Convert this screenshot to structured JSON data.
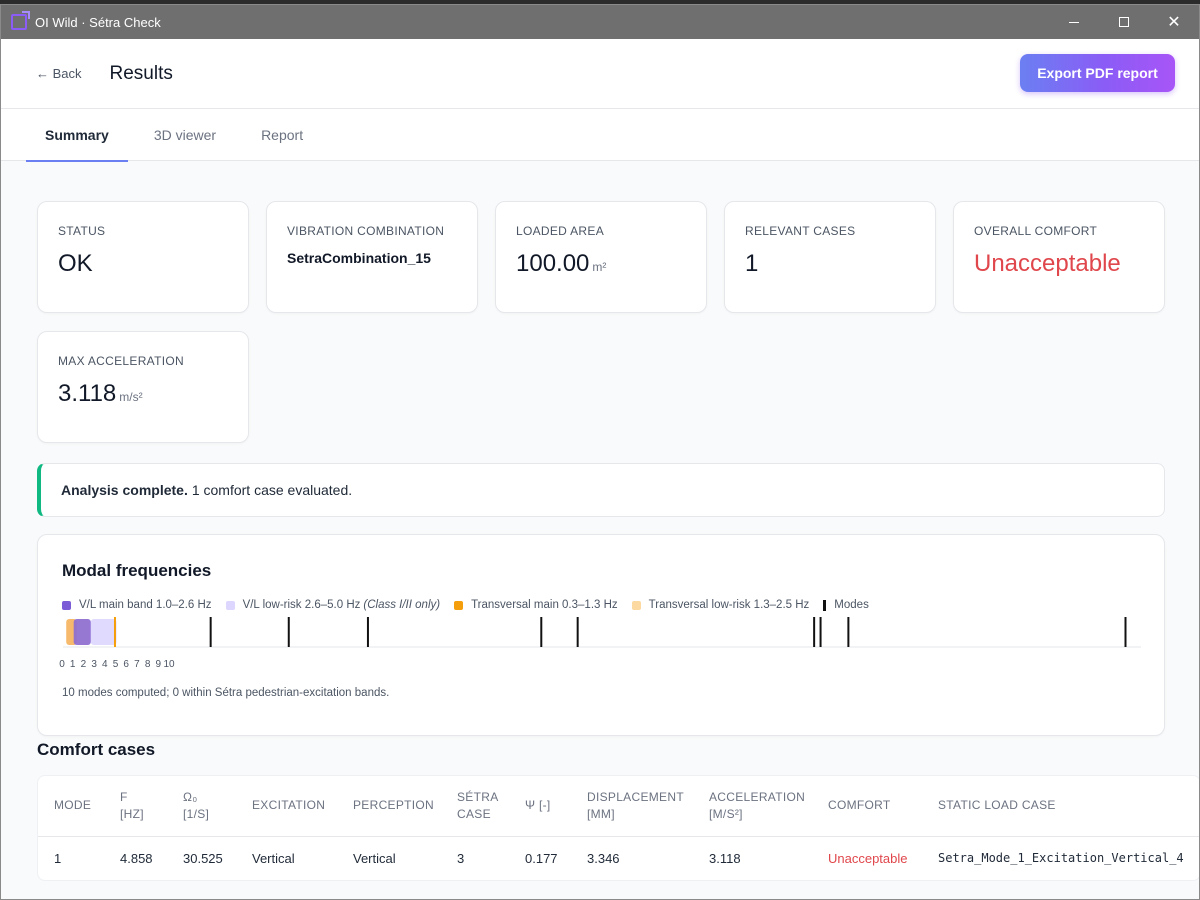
{
  "window": {
    "title": "OI Wild · Sétra Check"
  },
  "header": {
    "back_label": "← Back",
    "title": "Results",
    "export_label": "Export PDF report"
  },
  "tabs": [
    {
      "label": "Summary",
      "active": true
    },
    {
      "label": "3D viewer",
      "active": false
    },
    {
      "label": "Report",
      "active": false
    }
  ],
  "stats": {
    "status": {
      "label": "STATUS",
      "value": "OK"
    },
    "combination": {
      "label": "VIBRATION COMBINATION",
      "value": "SetraCombination_15"
    },
    "area": {
      "label": "LOADED AREA",
      "value": "100.00",
      "unit": "m²"
    },
    "cases": {
      "label": "RELEVANT CASES",
      "value": "1"
    },
    "comfort": {
      "label": "OVERALL COMFORT",
      "value": "Unacceptable"
    },
    "accel": {
      "label": "MAX ACCELERATION",
      "value": "3.118",
      "unit": "m/s²"
    }
  },
  "banner": {
    "strong": "Analysis complete.",
    "text": "1 comfort case evaluated."
  },
  "modal": {
    "title": "Modal frequencies",
    "legend": {
      "vl_main": "V/L main band 1.0–2.6 Hz",
      "vl_low": "V/L low-risk 2.6–5.0 Hz",
      "vl_low_note": "(Class I/II only)",
      "tr_main": "Transversal main 0.3–1.3 Hz",
      "tr_low": "Transversal low-risk 1.3–2.5 Hz",
      "modes": "Modes"
    },
    "note": "10 modes computed; 0 within Sétra pedestrian-excitation bands."
  },
  "chart_data": {
    "type": "scatter",
    "title": "Modal frequencies",
    "x_ticks": [
      "0",
      "1",
      "2",
      "3",
      "4",
      "5",
      "6",
      "7",
      "8",
      "9",
      "10"
    ],
    "bands": [
      {
        "name": "Transversal low-risk 1.3–2.5 Hz",
        "from": 1.3,
        "to": 2.5,
        "color": "#fcd9a0"
      },
      {
        "name": "Transversal main 0.3–1.3 Hz",
        "from": 0.3,
        "to": 1.3,
        "color": "#f6b35c"
      },
      {
        "name": "V/L low-risk 2.6–5.0 Hz",
        "from": 2.6,
        "to": 5.0,
        "color": "#ddd6fe"
      },
      {
        "name": "V/L main band 1.0–2.6 Hz",
        "from": 1.0,
        "to": 2.6,
        "color": "#8b6cd6"
      }
    ],
    "modes": [
      4.858,
      13.8,
      21.1,
      28.5,
      44.7,
      48.1,
      70.2,
      70.8,
      73.4,
      99.3
    ],
    "colors": {
      "transversal_main": "#f59e0b",
      "vl_main": "#7c5cd6",
      "mode": "#111111"
    }
  },
  "comfort": {
    "title": "Comfort cases",
    "columns": [
      [
        "MODE"
      ],
      [
        "F",
        "[HZ]"
      ],
      [
        "Ω₀",
        "[1/S]"
      ],
      [
        "EXCITATION"
      ],
      [
        "PERCEPTION"
      ],
      [
        "SÉTRA",
        "CASE"
      ],
      [
        "Ψ [-]"
      ],
      [
        "DISPLACEMENT",
        "[MM]"
      ],
      [
        "ACCELERATION",
        "[M/S²]"
      ],
      [
        "COMFORT"
      ],
      [
        "STATIC LOAD CASE"
      ]
    ],
    "rows": [
      [
        "1",
        "4.858",
        "30.525",
        "Vertical",
        "Vertical",
        "3",
        "0.177",
        "3.346",
        "3.118",
        "Unacceptable",
        "Setra_Mode_1_Excitation_Vertical_4"
      ]
    ]
  }
}
